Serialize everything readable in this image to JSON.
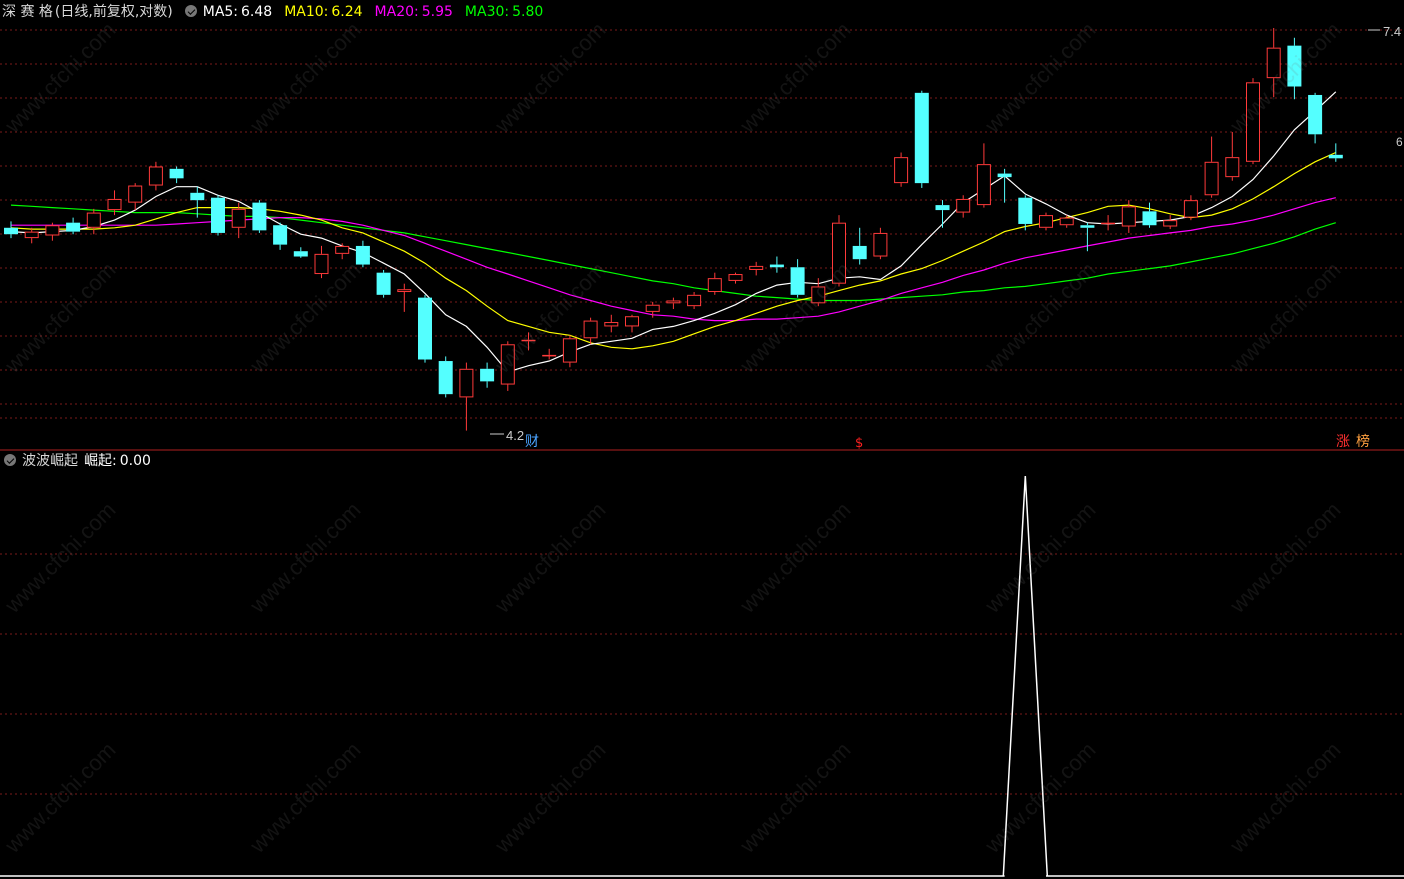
{
  "main_panel": {
    "stock_name": "深 赛 格",
    "chart_mode": "(日线,前复权,对数)",
    "ma_legend": [
      {
        "label": "MA5:",
        "value": "6.48",
        "color": "#ffffff"
      },
      {
        "label": "MA10:",
        "value": "6.24",
        "color": "#ffff00"
      },
      {
        "label": "MA20:",
        "value": "5.95",
        "color": "#ff00ff"
      },
      {
        "label": "MA30:",
        "value": "5.80",
        "color": "#00ff00"
      }
    ],
    "high_label": "7.4",
    "low_label": "4.2",
    "edge_label": "6",
    "markers": [
      {
        "text": "财",
        "color": "#4aa3ff"
      },
      {
        "text": "$",
        "color": "#ff2020"
      },
      {
        "text": "涨",
        "color": "#ff3030"
      },
      {
        "text": "榜",
        "color": "#ffa040"
      }
    ]
  },
  "sub_panel": {
    "indicator_name": "波波崛起",
    "value_label": "崛起:",
    "value": "0.00"
  },
  "watermark": "www.cfchi.com",
  "colors": {
    "up": "#ff3a3a",
    "down": "#54ffff",
    "ma5": "#ffffff",
    "ma10": "#ffff00",
    "ma20": "#ff00ff",
    "ma30": "#00ff00",
    "grid": "#7a1a1a",
    "divider": "#b02020",
    "signal": "#ffffff"
  },
  "chart_data": [
    {
      "type": "candlestick",
      "scale": "log",
      "price_range": [
        4.2,
        7.4
      ],
      "grid": true,
      "candles": [
        {
          "o": 5.6,
          "h": 5.65,
          "l": 5.52,
          "c": 5.55
        },
        {
          "o": 5.52,
          "h": 5.6,
          "l": 5.48,
          "c": 5.57
        },
        {
          "o": 5.54,
          "h": 5.64,
          "l": 5.5,
          "c": 5.62
        },
        {
          "o": 5.64,
          "h": 5.68,
          "l": 5.55,
          "c": 5.57
        },
        {
          "o": 5.6,
          "h": 5.75,
          "l": 5.55,
          "c": 5.72
        },
        {
          "o": 5.74,
          "h": 5.9,
          "l": 5.7,
          "c": 5.83
        },
        {
          "o": 5.8,
          "h": 5.96,
          "l": 5.74,
          "c": 5.94
        },
        {
          "o": 5.94,
          "h": 6.14,
          "l": 5.9,
          "c": 6.1
        },
        {
          "o": 6.08,
          "h": 6.1,
          "l": 5.96,
          "c": 6.0
        },
        {
          "o": 5.88,
          "h": 5.93,
          "l": 5.68,
          "c": 5.82
        },
        {
          "o": 5.84,
          "h": 5.86,
          "l": 5.54,
          "c": 5.56
        },
        {
          "o": 5.6,
          "h": 5.8,
          "l": 5.52,
          "c": 5.75
        },
        {
          "o": 5.8,
          "h": 5.82,
          "l": 5.56,
          "c": 5.58
        },
        {
          "o": 5.62,
          "h": 5.64,
          "l": 5.43,
          "c": 5.47
        },
        {
          "o": 5.42,
          "h": 5.45,
          "l": 5.37,
          "c": 5.38
        },
        {
          "o": 5.25,
          "h": 5.46,
          "l": 5.22,
          "c": 5.4
        },
        {
          "o": 5.4,
          "h": 5.48,
          "l": 5.36,
          "c": 5.46
        },
        {
          "o": 5.46,
          "h": 5.5,
          "l": 5.3,
          "c": 5.32
        },
        {
          "o": 5.26,
          "h": 5.28,
          "l": 5.08,
          "c": 5.1
        },
        {
          "o": 5.12,
          "h": 5.18,
          "l": 4.98,
          "c": 5.14
        },
        {
          "o": 5.08,
          "h": 5.1,
          "l": 4.64,
          "c": 4.66
        },
        {
          "o": 4.65,
          "h": 4.68,
          "l": 4.42,
          "c": 4.44
        },
        {
          "o": 4.42,
          "h": 4.64,
          "l": 4.22,
          "c": 4.6
        },
        {
          "o": 4.6,
          "h": 4.64,
          "l": 4.48,
          "c": 4.52
        },
        {
          "o": 4.5,
          "h": 4.78,
          "l": 4.46,
          "c": 4.76
        },
        {
          "o": 4.78,
          "h": 4.84,
          "l": 4.72,
          "c": 4.79
        },
        {
          "o": 4.68,
          "h": 4.73,
          "l": 4.66,
          "c": 4.69
        },
        {
          "o": 4.64,
          "h": 4.82,
          "l": 4.61,
          "c": 4.8
        },
        {
          "o": 4.8,
          "h": 4.94,
          "l": 4.76,
          "c": 4.92
        },
        {
          "o": 4.88,
          "h": 4.96,
          "l": 4.84,
          "c": 4.91
        },
        {
          "o": 4.88,
          "h": 4.96,
          "l": 4.84,
          "c": 4.95
        },
        {
          "o": 4.98,
          "h": 5.05,
          "l": 4.94,
          "c": 5.03
        },
        {
          "o": 5.04,
          "h": 5.08,
          "l": 5.0,
          "c": 5.06
        },
        {
          "o": 5.02,
          "h": 5.12,
          "l": 5.0,
          "c": 5.1
        },
        {
          "o": 5.12,
          "h": 5.26,
          "l": 5.1,
          "c": 5.22
        },
        {
          "o": 5.2,
          "h": 5.26,
          "l": 5.18,
          "c": 5.25
        },
        {
          "o": 5.28,
          "h": 5.34,
          "l": 5.24,
          "c": 5.31
        },
        {
          "o": 5.32,
          "h": 5.38,
          "l": 5.26,
          "c": 5.3
        },
        {
          "o": 5.3,
          "h": 5.36,
          "l": 5.08,
          "c": 5.1
        },
        {
          "o": 5.04,
          "h": 5.22,
          "l": 5.02,
          "c": 5.16
        },
        {
          "o": 5.18,
          "h": 5.7,
          "l": 5.16,
          "c": 5.64
        },
        {
          "o": 5.46,
          "h": 5.6,
          "l": 5.32,
          "c": 5.36
        },
        {
          "o": 5.38,
          "h": 5.6,
          "l": 5.36,
          "c": 5.56
        },
        {
          "o": 5.96,
          "h": 6.22,
          "l": 5.93,
          "c": 6.18
        },
        {
          "o": 6.76,
          "h": 6.78,
          "l": 5.92,
          "c": 5.96
        },
        {
          "o": 5.78,
          "h": 5.82,
          "l": 5.6,
          "c": 5.74
        },
        {
          "o": 5.72,
          "h": 5.86,
          "l": 5.68,
          "c": 5.83
        },
        {
          "o": 5.78,
          "h": 6.3,
          "l": 5.76,
          "c": 6.12
        },
        {
          "o": 6.04,
          "h": 6.08,
          "l": 5.8,
          "c": 6.01
        },
        {
          "o": 5.84,
          "h": 5.86,
          "l": 5.58,
          "c": 5.63
        },
        {
          "o": 5.6,
          "h": 5.72,
          "l": 5.58,
          "c": 5.7
        },
        {
          "o": 5.62,
          "h": 5.7,
          "l": 5.6,
          "c": 5.68
        },
        {
          "o": 5.62,
          "h": 5.64,
          "l": 5.42,
          "c": 5.6
        },
        {
          "o": 5.63,
          "h": 5.7,
          "l": 5.58,
          "c": 5.64
        },
        {
          "o": 5.61,
          "h": 5.82,
          "l": 5.56,
          "c": 5.77
        },
        {
          "o": 5.73,
          "h": 5.8,
          "l": 5.6,
          "c": 5.62
        },
        {
          "o": 5.61,
          "h": 5.7,
          "l": 5.59,
          "c": 5.66
        },
        {
          "o": 5.68,
          "h": 5.86,
          "l": 5.66,
          "c": 5.82
        },
        {
          "o": 5.86,
          "h": 6.36,
          "l": 5.84,
          "c": 6.14
        },
        {
          "o": 6.01,
          "h": 6.4,
          "l": 5.98,
          "c": 6.18
        },
        {
          "o": 6.14,
          "h": 6.9,
          "l": 6.12,
          "c": 6.86
        },
        {
          "o": 6.9,
          "h": 7.4,
          "l": 6.72,
          "c": 7.2
        },
        {
          "o": 7.22,
          "h": 7.3,
          "l": 6.7,
          "c": 6.82
        },
        {
          "o": 6.74,
          "h": 6.76,
          "l": 6.3,
          "c": 6.38
        },
        {
          "o": 6.2,
          "h": 6.3,
          "l": 6.14,
          "c": 6.17
        }
      ],
      "ma": {
        "MA5": [
          5.57,
          5.56,
          5.57,
          5.58,
          5.61,
          5.66,
          5.74,
          5.85,
          5.93,
          5.93,
          5.86,
          5.81,
          5.72,
          5.63,
          5.55,
          5.52,
          5.46,
          5.41,
          5.33,
          5.25,
          5.11,
          4.96,
          4.88,
          4.74,
          4.58,
          4.62,
          4.65,
          4.71,
          4.76,
          4.78,
          4.8,
          4.86,
          4.88,
          4.92,
          4.97,
          5.03,
          5.11,
          5.17,
          5.19,
          5.18,
          5.22,
          5.23,
          5.21,
          5.31,
          5.47,
          5.63,
          5.8,
          5.91,
          6.02,
          5.87,
          5.79,
          5.7,
          5.64,
          5.63,
          5.64,
          5.65,
          5.66,
          5.69,
          5.76,
          5.85,
          5.99,
          6.19,
          6.42,
          6.59,
          6.77
        ],
        "MA10": [
          5.6,
          5.59,
          5.59,
          5.59,
          5.59,
          5.6,
          5.62,
          5.67,
          5.72,
          5.76,
          5.76,
          5.76,
          5.75,
          5.73,
          5.7,
          5.66,
          5.6,
          5.56,
          5.49,
          5.42,
          5.33,
          5.22,
          5.13,
          5.02,
          4.92,
          4.88,
          4.84,
          4.82,
          4.77,
          4.74,
          4.73,
          4.75,
          4.78,
          4.83,
          4.88,
          4.92,
          4.97,
          5.02,
          5.06,
          5.09,
          5.13,
          5.17,
          5.2,
          5.25,
          5.29,
          5.35,
          5.42,
          5.49,
          5.57,
          5.61,
          5.64,
          5.68,
          5.72,
          5.77,
          5.78,
          5.75,
          5.71,
          5.68,
          5.7,
          5.75,
          5.83,
          5.93,
          6.04,
          6.14,
          6.22
        ],
        "MA20": [
          5.62,
          5.62,
          5.62,
          5.62,
          5.62,
          5.62,
          5.62,
          5.62,
          5.63,
          5.64,
          5.65,
          5.66,
          5.67,
          5.68,
          5.68,
          5.67,
          5.65,
          5.62,
          5.58,
          5.54,
          5.48,
          5.42,
          5.36,
          5.3,
          5.25,
          5.2,
          5.15,
          5.1,
          5.06,
          5.02,
          4.99,
          4.96,
          4.95,
          4.93,
          4.92,
          4.92,
          4.93,
          4.93,
          4.94,
          4.95,
          4.98,
          5.02,
          5.06,
          5.11,
          5.15,
          5.19,
          5.24,
          5.28,
          5.33,
          5.37,
          5.4,
          5.43,
          5.46,
          5.49,
          5.52,
          5.54,
          5.56,
          5.58,
          5.61,
          5.63,
          5.66,
          5.7,
          5.75,
          5.8,
          5.84
        ],
        "MA30": [
          5.78,
          5.77,
          5.76,
          5.75,
          5.74,
          5.73,
          5.72,
          5.72,
          5.72,
          5.71,
          5.7,
          5.69,
          5.69,
          5.68,
          5.66,
          5.64,
          5.62,
          5.6,
          5.58,
          5.56,
          5.53,
          5.5,
          5.47,
          5.44,
          5.41,
          5.38,
          5.35,
          5.32,
          5.29,
          5.26,
          5.23,
          5.2,
          5.18,
          5.15,
          5.13,
          5.11,
          5.09,
          5.08,
          5.07,
          5.06,
          5.06,
          5.06,
          5.07,
          5.08,
          5.09,
          5.1,
          5.12,
          5.13,
          5.15,
          5.16,
          5.18,
          5.2,
          5.22,
          5.25,
          5.27,
          5.29,
          5.31,
          5.34,
          5.37,
          5.4,
          5.44,
          5.48,
          5.53,
          5.59,
          5.64
        ]
      }
    },
    {
      "type": "line",
      "series": [
        {
          "name": "崛起",
          "values": [
            0,
            0,
            0,
            0,
            0,
            0,
            0,
            0,
            0,
            0,
            0,
            0,
            0,
            0,
            0,
            0,
            0,
            0,
            0,
            0,
            0,
            0,
            0,
            0,
            0,
            0,
            0,
            0,
            0,
            0,
            0,
            0,
            0,
            0,
            0,
            0,
            0,
            0,
            0,
            0,
            0,
            0,
            0,
            0,
            0,
            0,
            0,
            0,
            0,
            0,
            0,
            0,
            0,
            0,
            0,
            0,
            0,
            0,
            0,
            0,
            0,
            0,
            0,
            0,
            0
          ]
        }
      ],
      "spike": {
        "index": 49,
        "value": 1
      },
      "ylim": [
        0,
        1
      ],
      "grid": true
    }
  ]
}
